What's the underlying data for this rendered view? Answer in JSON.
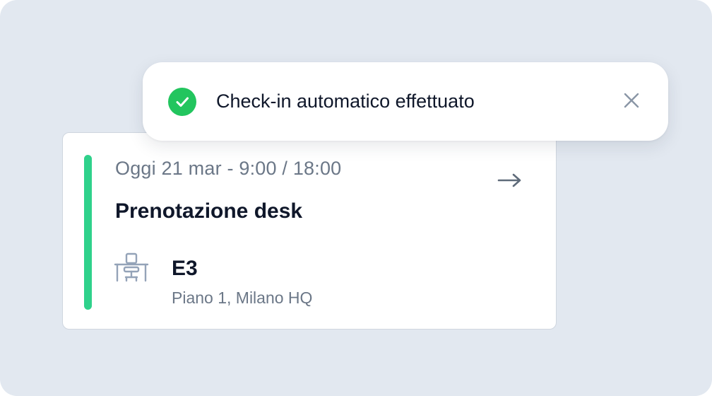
{
  "toast": {
    "message": "Check-in automatico effettuato",
    "status_icon": "check-circle-icon",
    "close_icon": "close-icon",
    "success_color": "#22c55e"
  },
  "booking": {
    "datetime": "Oggi 21 mar - 9:00 / 18:00",
    "title": "Prenotazione desk",
    "desk_code": "E3",
    "location": "Piano 1, Milano HQ",
    "resource_icon": "desk-chair-icon",
    "action_icon": "arrow-right-icon",
    "accent_color": "#2fd18b"
  }
}
